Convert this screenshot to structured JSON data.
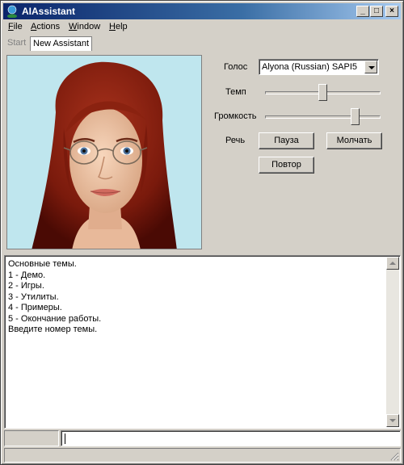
{
  "window": {
    "title": "AIAssistant"
  },
  "titlebar_buttons": {
    "minimize": "_",
    "maximize": "□",
    "close": "×"
  },
  "menu": [
    {
      "label": "File",
      "accel": "F",
      "rest": "ile"
    },
    {
      "label": "Actions",
      "accel": "A",
      "rest": "ctions"
    },
    {
      "label": "Window",
      "accel": "W",
      "rest": "indow"
    },
    {
      "label": "Help",
      "accel": "H",
      "rest": "elp"
    }
  ],
  "tabs": {
    "start": "Start",
    "active": "New Assistant"
  },
  "avatar": {
    "icon": "female-avatar-3d"
  },
  "controls": {
    "voice_label": "Голос",
    "voice_value": "Alyona (Russian) SAPI5",
    "rate_label": "Темп",
    "rate_level": 0.5,
    "volume_label": "Громкость",
    "volume_level": 0.8,
    "speech_label": "Речь",
    "pause_button": "Пауза",
    "mute_button": "Молчать",
    "repeat_button": "Повтор"
  },
  "output_lines": [
    "Основные темы.",
    "1 - Демо.",
    "2 - Игры.",
    "3 - Утилиты.",
    "4 - Примеры.",
    "5 - Окончание работы.",
    "Введите номер темы."
  ],
  "input": {
    "value": ""
  },
  "colors": {
    "titlebar_start": "#0a246a",
    "titlebar_end": "#a6caf0",
    "avatar_bg": "#bfe6ee"
  }
}
